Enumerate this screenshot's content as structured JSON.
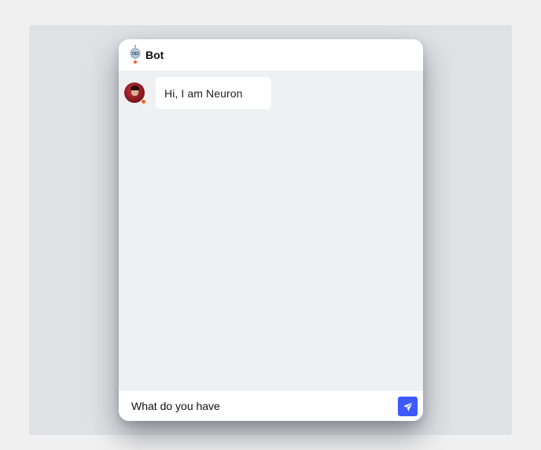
{
  "header": {
    "title": "Bot",
    "logo_icon": "robot-icon",
    "status_color": "#ff5a1f"
  },
  "messages": [
    {
      "sender": "bot",
      "avatar_icon": "avatar",
      "text": "Hi, I am Neuron"
    }
  ],
  "composer": {
    "value": "What do you have",
    "send_icon": "paper-plane-icon",
    "accent_color": "#3d5afe"
  }
}
